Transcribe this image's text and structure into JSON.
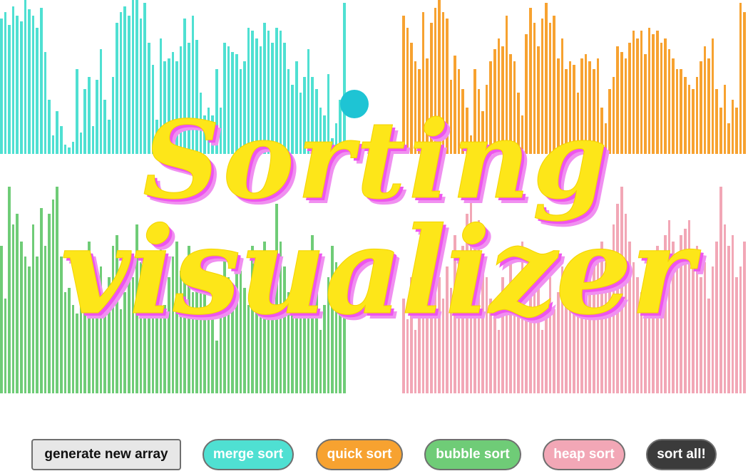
{
  "title": {
    "line1": "Sorting",
    "line2": "visualizer"
  },
  "colors": {
    "merge": "#4fe0d2",
    "quick": "#f7a230",
    "bubble": "#6fcc77",
    "heap": "#f2a7b6",
    "sort_all": "#3b3b3b",
    "title_fill": "#fde619",
    "title_shadow": "#ee55ee"
  },
  "buttons": {
    "generate": "generate new array",
    "merge": "merge sort",
    "quick": "quick sort",
    "bubble": "bubble sort",
    "heap": "heap sort",
    "sort_all": "sort all!"
  },
  "arrays": {
    "merge": [
      0.88,
      0.92,
      0.84,
      0.96,
      0.9,
      0.86,
      1.0,
      0.94,
      0.9,
      0.82,
      0.95,
      0.66,
      0.35,
      0.12,
      0.28,
      0.18,
      0.06,
      0.04,
      0.08,
      0.55,
      0.14,
      0.42,
      0.5,
      0.18,
      0.48,
      0.68,
      0.35,
      0.22,
      0.5,
      0.85,
      0.92,
      0.96,
      0.9,
      1.0,
      1.0,
      0.88,
      0.98,
      0.72,
      0.58,
      0.22,
      0.75,
      0.6,
      0.62,
      0.66,
      0.6,
      0.7,
      0.88,
      0.72,
      0.9,
      0.74,
      0.4,
      0.25,
      0.3,
      0.25,
      0.55,
      0.3,
      0.72,
      0.7,
      0.66,
      0.65,
      0.55,
      0.6,
      0.82,
      0.8,
      0.75,
      0.7,
      0.85,
      0.8,
      0.72,
      0.82,
      0.8,
      0.72,
      0.55,
      0.45,
      0.6,
      0.4,
      0.5,
      0.68,
      0.5,
      0.42,
      0.3,
      0.25,
      0.52,
      0.1,
      0.2,
      0.35,
      0.98
    ],
    "quick": [
      0.9,
      0.82,
      0.72,
      0.6,
      0.55,
      0.92,
      0.62,
      0.85,
      0.95,
      1.0,
      0.92,
      0.88,
      0.48,
      0.64,
      0.55,
      0.42,
      0.3,
      0.12,
      0.55,
      0.42,
      0.28,
      0.45,
      0.6,
      0.68,
      0.75,
      0.7,
      0.9,
      0.65,
      0.6,
      0.4,
      0.25,
      0.78,
      0.95,
      0.85,
      0.7,
      0.88,
      0.98,
      0.85,
      0.9,
      0.62,
      0.75,
      0.55,
      0.6,
      0.58,
      0.4,
      0.62,
      0.65,
      0.6,
      0.55,
      0.62,
      0.3,
      0.2,
      0.42,
      0.5,
      0.7,
      0.66,
      0.62,
      0.72,
      0.8,
      0.75,
      0.8,
      0.65,
      0.82,
      0.78,
      0.8,
      0.72,
      0.75,
      0.68,
      0.62,
      0.55,
      0.55,
      0.5,
      0.45,
      0.42,
      0.5,
      0.6,
      0.7,
      0.62,
      0.75,
      0.42,
      0.3,
      0.45,
      0.2,
      0.35,
      0.3,
      0.98,
      0.92
    ],
    "bubble": [
      0.7,
      0.45,
      0.98,
      0.8,
      0.85,
      0.72,
      0.65,
      0.6,
      0.8,
      0.65,
      0.88,
      0.7,
      0.85,
      0.92,
      0.98,
      0.65,
      0.48,
      0.5,
      0.42,
      0.38,
      0.45,
      0.55,
      0.72,
      0.62,
      0.52,
      0.6,
      0.45,
      0.55,
      0.7,
      0.75,
      0.4,
      0.48,
      0.6,
      0.55,
      0.8,
      0.62,
      0.45,
      0.66,
      0.5,
      0.6,
      0.75,
      0.42,
      0.55,
      0.65,
      0.72,
      0.58,
      0.62,
      0.7,
      0.48,
      0.5,
      0.62,
      0.58,
      0.4,
      0.35,
      0.25,
      0.5,
      0.68,
      0.55,
      0.48,
      0.66,
      0.58,
      0.5,
      0.42,
      0.7,
      0.6,
      0.45,
      0.72,
      0.62,
      0.55,
      0.9,
      0.72,
      0.6,
      0.48,
      0.42,
      0.55,
      0.45,
      0.5,
      0.62,
      0.75,
      0.5,
      0.3,
      0.42,
      0.55,
      0.7,
      0.62,
      0.5,
      0.45
    ],
    "heap": [
      0.45,
      0.35,
      0.55,
      0.3,
      0.62,
      0.4,
      0.5,
      0.38,
      0.72,
      0.55,
      0.45,
      0.6,
      0.5,
      0.75,
      0.62,
      0.7,
      0.85,
      0.92,
      0.78,
      0.82,
      0.65,
      0.55,
      0.45,
      0.4,
      0.3,
      0.55,
      0.5,
      0.62,
      0.42,
      0.45,
      0.72,
      0.4,
      0.5,
      0.65,
      0.55,
      0.3,
      0.42,
      0.55,
      0.4,
      0.48,
      0.6,
      0.55,
      0.5,
      0.45,
      0.38,
      0.5,
      0.62,
      0.55,
      0.6,
      0.66,
      0.72,
      0.62,
      0.55,
      0.8,
      0.9,
      0.98,
      0.85,
      0.72,
      0.62,
      0.55,
      0.48,
      0.45,
      0.62,
      0.55,
      0.7,
      0.62,
      0.75,
      0.82,
      0.72,
      0.62,
      0.75,
      0.78,
      0.82,
      0.62,
      0.7,
      0.55,
      0.62,
      0.45,
      0.6,
      0.72,
      0.98,
      0.8,
      0.7,
      0.75,
      0.55,
      0.6,
      0.72
    ]
  }
}
